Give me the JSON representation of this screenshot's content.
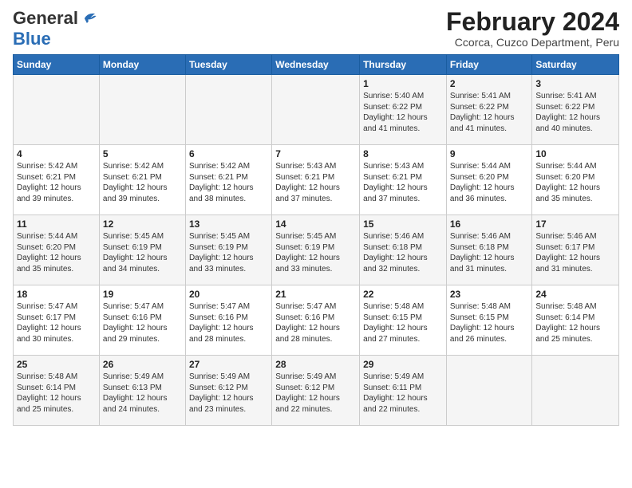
{
  "header": {
    "logo_general": "General",
    "logo_blue": "Blue",
    "title": "February 2024",
    "subtitle": "Ccorca, Cuzco Department, Peru"
  },
  "weekdays": [
    "Sunday",
    "Monday",
    "Tuesday",
    "Wednesday",
    "Thursday",
    "Friday",
    "Saturday"
  ],
  "weeks": [
    [
      {
        "day": "",
        "detail": ""
      },
      {
        "day": "",
        "detail": ""
      },
      {
        "day": "",
        "detail": ""
      },
      {
        "day": "",
        "detail": ""
      },
      {
        "day": "1",
        "detail": "Sunrise: 5:40 AM\nSunset: 6:22 PM\nDaylight: 12 hours\nand 41 minutes."
      },
      {
        "day": "2",
        "detail": "Sunrise: 5:41 AM\nSunset: 6:22 PM\nDaylight: 12 hours\nand 41 minutes."
      },
      {
        "day": "3",
        "detail": "Sunrise: 5:41 AM\nSunset: 6:22 PM\nDaylight: 12 hours\nand 40 minutes."
      }
    ],
    [
      {
        "day": "4",
        "detail": "Sunrise: 5:42 AM\nSunset: 6:21 PM\nDaylight: 12 hours\nand 39 minutes."
      },
      {
        "day": "5",
        "detail": "Sunrise: 5:42 AM\nSunset: 6:21 PM\nDaylight: 12 hours\nand 39 minutes."
      },
      {
        "day": "6",
        "detail": "Sunrise: 5:42 AM\nSunset: 6:21 PM\nDaylight: 12 hours\nand 38 minutes."
      },
      {
        "day": "7",
        "detail": "Sunrise: 5:43 AM\nSunset: 6:21 PM\nDaylight: 12 hours\nand 37 minutes."
      },
      {
        "day": "8",
        "detail": "Sunrise: 5:43 AM\nSunset: 6:21 PM\nDaylight: 12 hours\nand 37 minutes."
      },
      {
        "day": "9",
        "detail": "Sunrise: 5:44 AM\nSunset: 6:20 PM\nDaylight: 12 hours\nand 36 minutes."
      },
      {
        "day": "10",
        "detail": "Sunrise: 5:44 AM\nSunset: 6:20 PM\nDaylight: 12 hours\nand 35 minutes."
      }
    ],
    [
      {
        "day": "11",
        "detail": "Sunrise: 5:44 AM\nSunset: 6:20 PM\nDaylight: 12 hours\nand 35 minutes."
      },
      {
        "day": "12",
        "detail": "Sunrise: 5:45 AM\nSunset: 6:19 PM\nDaylight: 12 hours\nand 34 minutes."
      },
      {
        "day": "13",
        "detail": "Sunrise: 5:45 AM\nSunset: 6:19 PM\nDaylight: 12 hours\nand 33 minutes."
      },
      {
        "day": "14",
        "detail": "Sunrise: 5:45 AM\nSunset: 6:19 PM\nDaylight: 12 hours\nand 33 minutes."
      },
      {
        "day": "15",
        "detail": "Sunrise: 5:46 AM\nSunset: 6:18 PM\nDaylight: 12 hours\nand 32 minutes."
      },
      {
        "day": "16",
        "detail": "Sunrise: 5:46 AM\nSunset: 6:18 PM\nDaylight: 12 hours\nand 31 minutes."
      },
      {
        "day": "17",
        "detail": "Sunrise: 5:46 AM\nSunset: 6:17 PM\nDaylight: 12 hours\nand 31 minutes."
      }
    ],
    [
      {
        "day": "18",
        "detail": "Sunrise: 5:47 AM\nSunset: 6:17 PM\nDaylight: 12 hours\nand 30 minutes."
      },
      {
        "day": "19",
        "detail": "Sunrise: 5:47 AM\nSunset: 6:16 PM\nDaylight: 12 hours\nand 29 minutes."
      },
      {
        "day": "20",
        "detail": "Sunrise: 5:47 AM\nSunset: 6:16 PM\nDaylight: 12 hours\nand 28 minutes."
      },
      {
        "day": "21",
        "detail": "Sunrise: 5:47 AM\nSunset: 6:16 PM\nDaylight: 12 hours\nand 28 minutes."
      },
      {
        "day": "22",
        "detail": "Sunrise: 5:48 AM\nSunset: 6:15 PM\nDaylight: 12 hours\nand 27 minutes."
      },
      {
        "day": "23",
        "detail": "Sunrise: 5:48 AM\nSunset: 6:15 PM\nDaylight: 12 hours\nand 26 minutes."
      },
      {
        "day": "24",
        "detail": "Sunrise: 5:48 AM\nSunset: 6:14 PM\nDaylight: 12 hours\nand 25 minutes."
      }
    ],
    [
      {
        "day": "25",
        "detail": "Sunrise: 5:48 AM\nSunset: 6:14 PM\nDaylight: 12 hours\nand 25 minutes."
      },
      {
        "day": "26",
        "detail": "Sunrise: 5:49 AM\nSunset: 6:13 PM\nDaylight: 12 hours\nand 24 minutes."
      },
      {
        "day": "27",
        "detail": "Sunrise: 5:49 AM\nSunset: 6:12 PM\nDaylight: 12 hours\nand 23 minutes."
      },
      {
        "day": "28",
        "detail": "Sunrise: 5:49 AM\nSunset: 6:12 PM\nDaylight: 12 hours\nand 22 minutes."
      },
      {
        "day": "29",
        "detail": "Sunrise: 5:49 AM\nSunset: 6:11 PM\nDaylight: 12 hours\nand 22 minutes."
      },
      {
        "day": "",
        "detail": ""
      },
      {
        "day": "",
        "detail": ""
      }
    ]
  ]
}
